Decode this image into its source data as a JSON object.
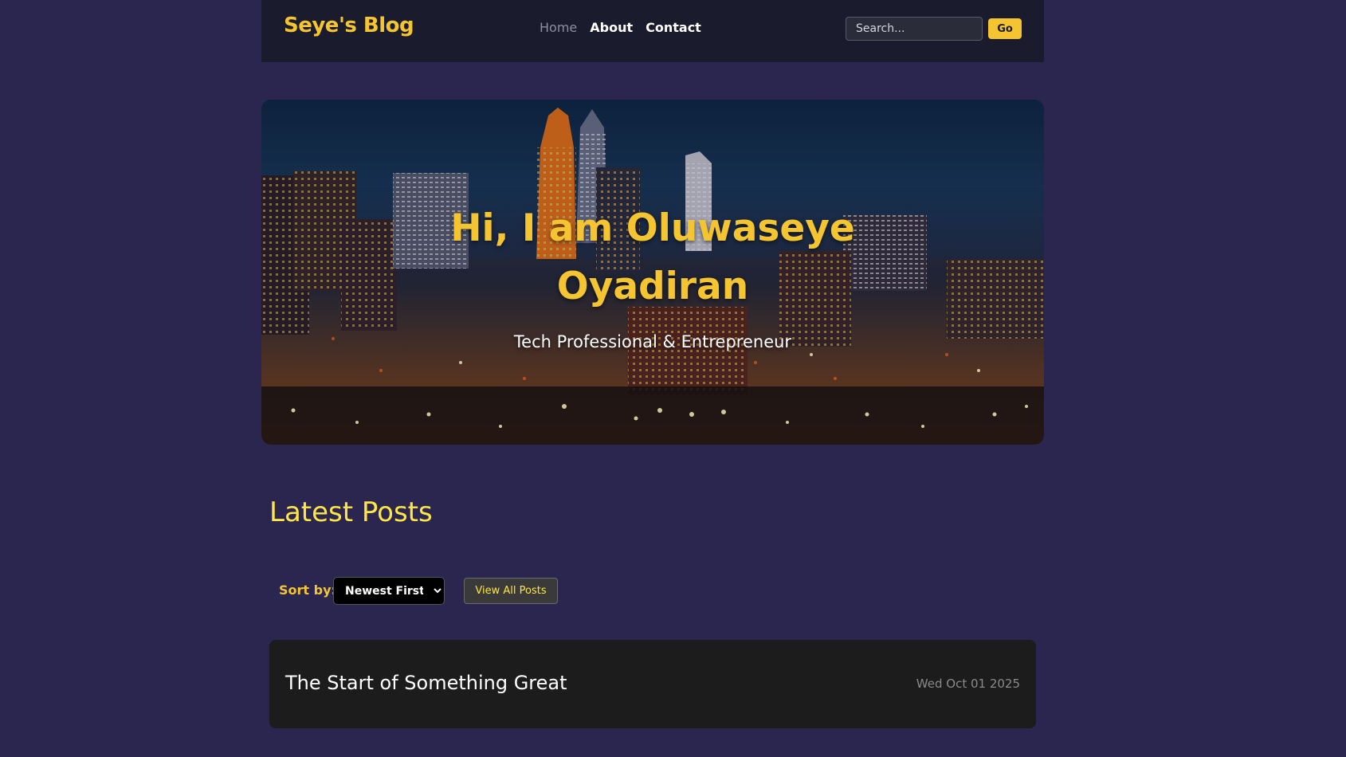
{
  "navbar": {
    "brand": "Seye's Blog",
    "links": [
      {
        "label": "Home"
      },
      {
        "label": "About"
      },
      {
        "label": "Contact"
      }
    ],
    "search": {
      "placeholder": "Search...",
      "value": ""
    },
    "go_label": "Go"
  },
  "hero": {
    "title_line1": "Hi, I am Oluwaseye",
    "title_line2": "Oyadiran",
    "subtitle": "Tech Professional & Entrepreneur"
  },
  "posts_section": {
    "title": "Latest Posts",
    "sort_label": "Sort by:",
    "sort_selected": "Newest First",
    "view_all_label": "View All Posts",
    "posts": [
      {
        "title": "The Start of Something Great",
        "date": "Wed Oct 01 2025"
      }
    ]
  },
  "colors": {
    "background": "#2a2650",
    "navbar": "#1b1b2e",
    "accent": "#f5c431",
    "section_title": "#ffe545",
    "card": "#1c1c1c"
  }
}
